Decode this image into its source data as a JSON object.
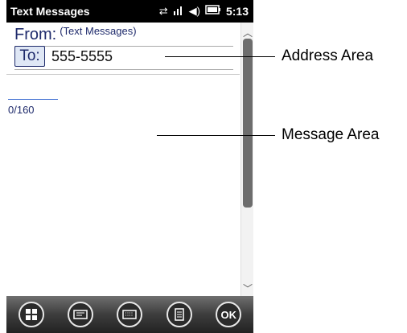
{
  "status_bar": {
    "title": "Text Messages",
    "time": "5:13",
    "icons": [
      "connectivity-icon",
      "signal-icon",
      "volume-icon",
      "battery-icon"
    ]
  },
  "compose": {
    "from_label": "From:",
    "from_value": "(Text Messages)",
    "to_label": "To:",
    "to_value": "555-5555",
    "char_count": "0/160"
  },
  "toolbar": {
    "buttons": [
      "windows-start-icon",
      "sms-compose-icon",
      "keyboard-icon",
      "menu-icon",
      "OK"
    ]
  },
  "callouts": {
    "address_area": "Address Area",
    "message_area": "Message Area"
  }
}
